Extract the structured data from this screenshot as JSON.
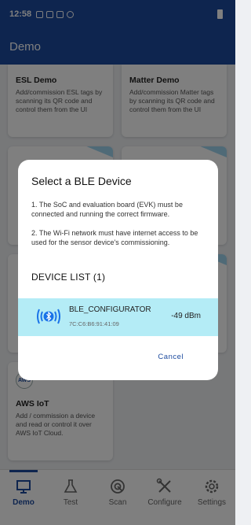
{
  "status_bar": {
    "time": "12:58"
  },
  "app_bar": {
    "title": "Demo"
  },
  "cards": [
    {
      "title": "ESL Demo",
      "desc": "Add/commission ESL tags by scanning its QR code and control them from the UI"
    },
    {
      "title": "Matter Demo",
      "desc": "Add/commission Matter tags by scanning its QR code and control them from the UI"
    },
    {
      "title": "AWS IoT",
      "desc": "Add / commission a device and read or control it over AWS IoT Cloud.",
      "badge": "AWS"
    }
  ],
  "dialog": {
    "title": "Select a BLE Device",
    "note_1": "1. The SoC and evaluation board (EVK) must be connected and running the correct firmware.",
    "note_2": "2. The Wi-Fi network must have internet access to be used for the sensor device's commissioning.",
    "device_list_label": "DEVICE LIST (1)",
    "devices": [
      {
        "name": "BLE_CONFIGURATOR",
        "mac": "7C:C6:B6:91:41:09",
        "rssi": "-49 dBm"
      }
    ],
    "cancel_label": "Cancel"
  },
  "bottom_nav": [
    {
      "label": "Demo",
      "icon": "demo-board-icon",
      "active": true
    },
    {
      "label": "Test",
      "icon": "flask-icon",
      "active": false
    },
    {
      "label": "Scan",
      "icon": "scan-icon",
      "active": false
    },
    {
      "label": "Configure",
      "icon": "tools-icon",
      "active": false
    },
    {
      "label": "Settings",
      "icon": "gear-icon",
      "active": false
    }
  ],
  "colors": {
    "primary": "#1c4a9e",
    "selected_row": "#b4ecf6",
    "bluetooth": "#1a73e8"
  }
}
